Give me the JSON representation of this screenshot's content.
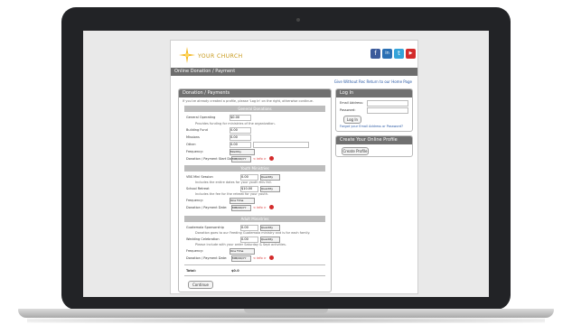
{
  "site": {
    "logo_text": "YOUR CHURCH",
    "social": [
      {
        "name": "facebook-icon",
        "glyph": "f",
        "color": "#3b5a9a"
      },
      {
        "name": "linkedin-icon",
        "glyph": "in",
        "color": "#2a6fb3"
      },
      {
        "name": "twitter-icon",
        "glyph": "t",
        "color": "#34a3d9"
      },
      {
        "name": "youtube-icon",
        "glyph": "▶",
        "color": "#d32b2b"
      }
    ],
    "page_title": "Online Donation / Payment",
    "top_links": "Give Without Rec   Return to our Home Page"
  },
  "form": {
    "title": "Donation / Payments",
    "intro": "If you've already created a profile, please 'Log In' on the right, otherwise continue.",
    "sections": [
      {
        "header": "General Donations",
        "rows": [
          {
            "label": "General Operating",
            "value": "$0.00"
          },
          {
            "label": "",
            "note": "Provides funding for ministries of the organization."
          },
          {
            "label": "Building Fund",
            "value": "0.00"
          },
          {
            "label": "Missions",
            "value": "0.00"
          },
          {
            "label": "Other:",
            "value": "0.00"
          },
          {
            "label": "Frequency:",
            "select": "Monthly"
          },
          {
            "label": "Donation / Payment Start Date:",
            "select": "MM/DD/YY",
            "red": "< info >"
          }
        ]
      },
      {
        "header": "Youth Ministries",
        "rows": [
          {
            "label": "VBS Mini Session",
            "value": "0.00",
            "select": "Quantity"
          },
          {
            "label": "",
            "note": "Includes the entire dates for your youth this fall."
          },
          {
            "label": "School Retreat",
            "value": "$10.00",
            "select": "Quantity"
          },
          {
            "label": "",
            "note": "Includes the fee for the retreat for your youth."
          },
          {
            "label": "Frequency:",
            "select": "One Time"
          },
          {
            "label": "Donation / Payment Date:",
            "select": "MM/DD/YY",
            "red": "< info >"
          }
        ]
      },
      {
        "header": "Adult Ministries",
        "rows": [
          {
            "label": "Guatemala Sponsorship",
            "value": "0.00",
            "select": "Quantity"
          },
          {
            "label": "",
            "note": "Donation goes to our Feeding Guatemala ministry and is for each family."
          },
          {
            "label": "Wedding Celebration",
            "value": "0.00",
            "select": "Quantity"
          },
          {
            "label": "",
            "note": "Please include with your order Saturday & Sept activities."
          },
          {
            "label": "Frequency:",
            "select": "One Time"
          },
          {
            "label": "Donation / Payment Date:",
            "select": "MM/DD/YY",
            "red": "< info >"
          }
        ]
      }
    ],
    "total_label": "Total:",
    "total_value": "$0.0",
    "submit": "Continue"
  },
  "login": {
    "title": "Log In",
    "email_label": "Email Address:",
    "password_label": "Password:",
    "button": "Log In",
    "forgot": "Forgot your Email Address or Password?"
  },
  "profile": {
    "title": "Create Your Online Profile",
    "button": "Create Profile"
  }
}
